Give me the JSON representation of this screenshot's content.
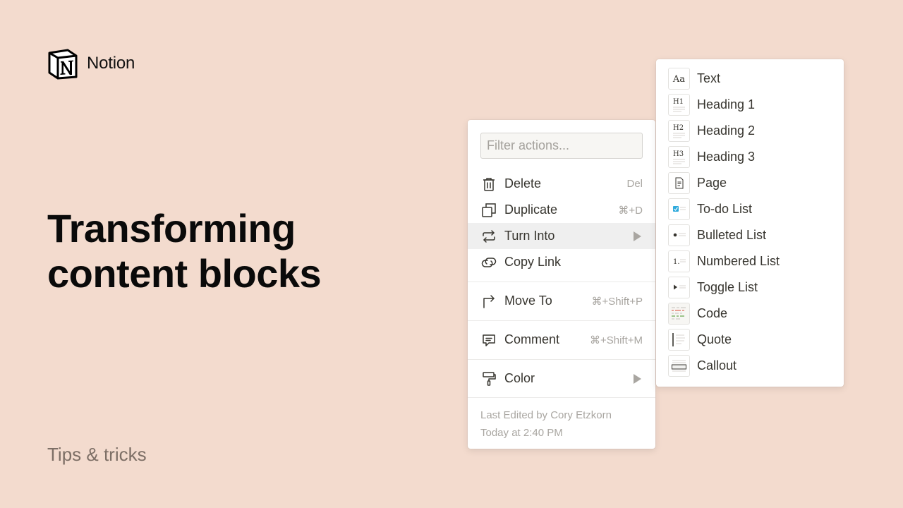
{
  "brand": {
    "name": "Notion",
    "logo_icon": "notion-logo-icon"
  },
  "headline": {
    "line1": "Transforming",
    "line2": "content blocks"
  },
  "subtitle": "Tips & tricks",
  "menu": {
    "filter_placeholder": "Filter actions...",
    "items": [
      {
        "label": "Delete",
        "shortcut": "Del",
        "icon": "trash-icon"
      },
      {
        "label": "Duplicate",
        "shortcut": "⌘+D",
        "icon": "duplicate-icon"
      },
      {
        "label": "Turn Into",
        "shortcut": "",
        "icon": "turn-into-icon",
        "submenu": true,
        "active": true
      },
      {
        "label": "Copy Link",
        "shortcut": "",
        "icon": "link-icon"
      },
      {
        "label": "Move To",
        "shortcut": "⌘+Shift+P",
        "icon": "move-to-icon"
      },
      {
        "label": "Comment",
        "shortcut": "⌘+Shift+M",
        "icon": "comment-icon"
      },
      {
        "label": "Color",
        "shortcut": "",
        "icon": "paint-roller-icon",
        "submenu": true
      }
    ],
    "meta": {
      "line1": "Last Edited by Cory Etzkorn",
      "line2": "Today at 2:40 PM"
    }
  },
  "submenu": {
    "items": [
      {
        "label": "Text",
        "icon": "text-block-icon"
      },
      {
        "label": "Heading 1",
        "icon": "heading1-block-icon"
      },
      {
        "label": "Heading 2",
        "icon": "heading2-block-icon"
      },
      {
        "label": "Heading 3",
        "icon": "heading3-block-icon"
      },
      {
        "label": "Page",
        "icon": "page-block-icon"
      },
      {
        "label": "To-do List",
        "icon": "todo-block-icon"
      },
      {
        "label": "Bulleted List",
        "icon": "bulleted-list-block-icon"
      },
      {
        "label": "Numbered List",
        "icon": "numbered-list-block-icon"
      },
      {
        "label": "Toggle List",
        "icon": "toggle-list-block-icon"
      },
      {
        "label": "Code",
        "icon": "code-block-icon"
      },
      {
        "label": "Quote",
        "icon": "quote-block-icon"
      },
      {
        "label": "Callout",
        "icon": "callout-block-icon"
      }
    ]
  },
  "colors": {
    "background": "#f3dbce",
    "menu_text": "#37352f",
    "muted": "#a9a6a1",
    "hover": "#efefef",
    "checkbox": "#2eaadc"
  }
}
